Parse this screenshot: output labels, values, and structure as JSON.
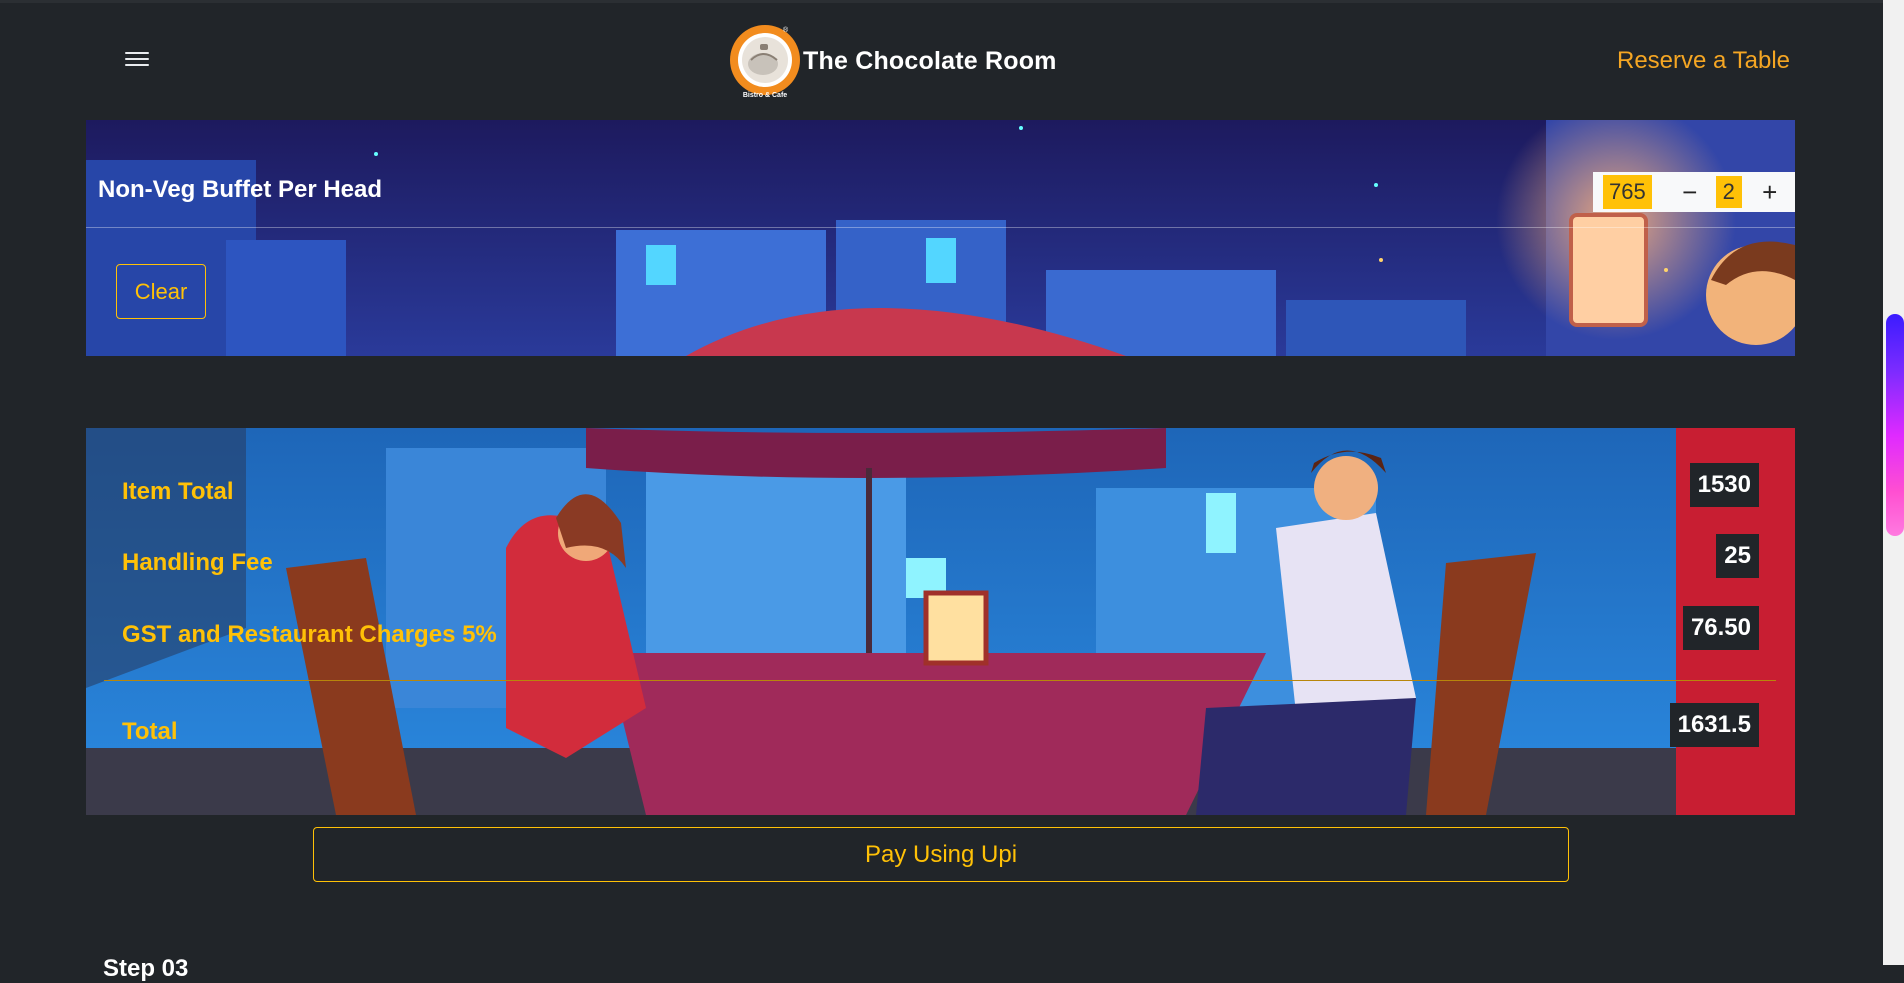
{
  "header": {
    "brand_name": "The Chocolate Room",
    "logo_ring_text": "the chocolate room",
    "logo_sub_text": "Bistro & Cafe",
    "reserve_label": "Reserve a Table"
  },
  "order_item": {
    "title": "Non-Veg Buffet Per Head",
    "price": "765",
    "quantity": "2",
    "minus_label": "−",
    "plus_label": "+",
    "clear_label": "Clear"
  },
  "summary": {
    "rows": [
      {
        "label": "Item Total",
        "value": "1530"
      },
      {
        "label": "Handling Fee",
        "value": "25"
      },
      {
        "label": "GST and Restaurant Charges 5%",
        "value": "76.50"
      }
    ],
    "total_label": "Total",
    "total_value": "1631.5"
  },
  "pay_label": "Pay Using Upi",
  "step_label": "Step 03",
  "colors": {
    "background": "#212529",
    "accent": "#ffc107",
    "reserve": "#f5a623"
  },
  "icons": [
    "menu-icon",
    "minus-icon",
    "plus-icon"
  ]
}
